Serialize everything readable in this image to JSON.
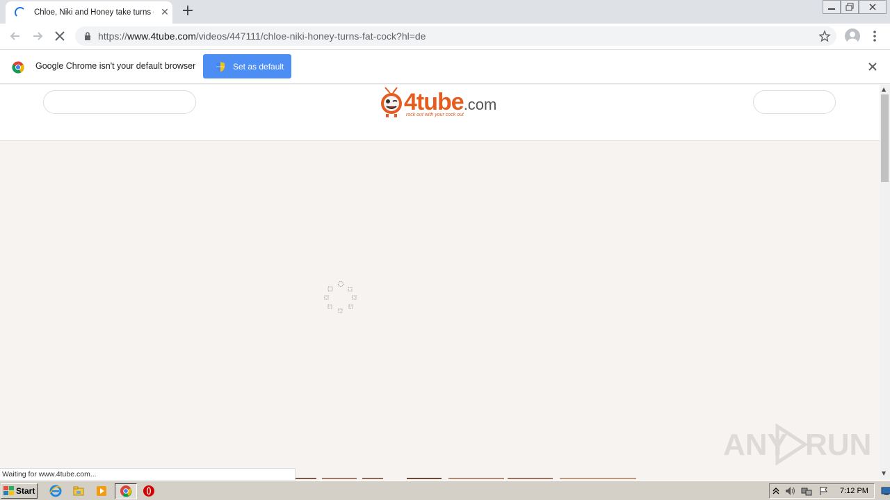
{
  "browser": {
    "tab": {
      "title": "Chloe, Niki and Honey take turns on",
      "loading": true
    },
    "new_tab_symbol": "+",
    "address": {
      "scheme": "https://",
      "host": "www.4tube.com",
      "path": "/videos/447111/chloe-niki-honey-turns-fat-cock?hl=de"
    },
    "infobar": {
      "message": "Google Chrome isn't your default browser",
      "button_label": "Set as default"
    },
    "status_text": "Waiting for www.4tube.com..."
  },
  "site": {
    "logo_text": "4tube",
    "logo_suffix": ".com",
    "logo_tagline": "rock out with your cock out",
    "brand_color": "#e45c1f"
  },
  "watermark": {
    "left": "ANY",
    "right": "RUN"
  },
  "taskbar": {
    "start_label": "Start",
    "clock": "7:12 PM",
    "pinned": [
      "ie-icon",
      "explorer-icon",
      "media-player-icon",
      "chrome-icon",
      "opera-icon"
    ]
  },
  "colors": {
    "accent": "#1a73e8",
    "button_blue": "#4d8ef5"
  }
}
